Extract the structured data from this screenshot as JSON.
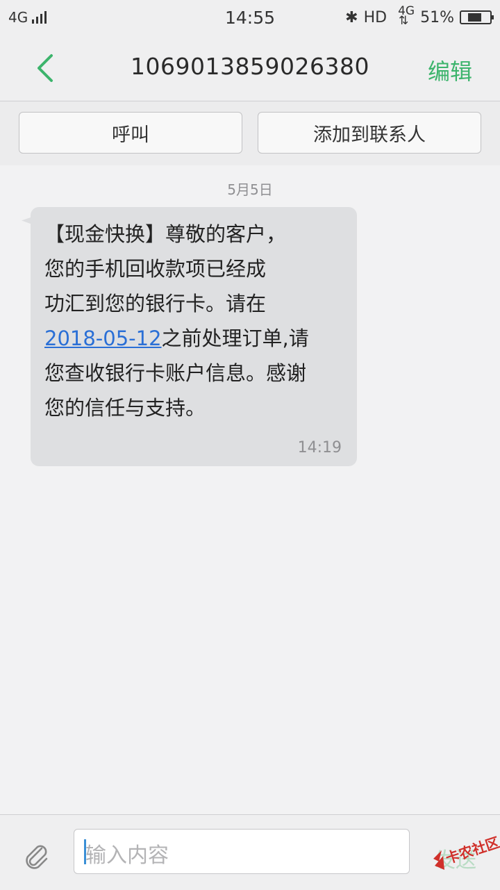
{
  "status_bar": {
    "network": "4G",
    "time": "14:55",
    "hd": "HD",
    "net_type": "4G",
    "battery_percent": "51%",
    "battery_level": 0.51,
    "icons": [
      "signal-icon",
      "bluetooth-icon",
      "data-arrows-icon",
      "battery-icon"
    ]
  },
  "header": {
    "back_icon": "chevron-left-icon",
    "title": "1069013859026380",
    "edit_label": "编辑"
  },
  "actions": {
    "call_label": "呼叫",
    "add_contact_label": "添加到联系人"
  },
  "conversation": {
    "date": "5月5日",
    "message": {
      "lines": [
        "【现金快换】尊敬的客户，",
        "您的手机回收款项已经成",
        "功汇到您的银行卡。请在"
      ],
      "link_text": "2018-05-12",
      "after_link": "之前处理订单,请",
      "lines_end": [
        "您查收银行卡账户信息。感谢",
        "您的信任与支持。"
      ],
      "time": "14:19"
    }
  },
  "composer": {
    "attach_icon": "paperclip-icon",
    "placeholder": "输入内容",
    "send_label": "发送"
  },
  "watermark": {
    "text": "卡农社区"
  },
  "colors": {
    "accent": "#3cb46c",
    "link": "#2a6fd6",
    "bubble": "#dedfe1",
    "background": "#f2f2f3"
  }
}
